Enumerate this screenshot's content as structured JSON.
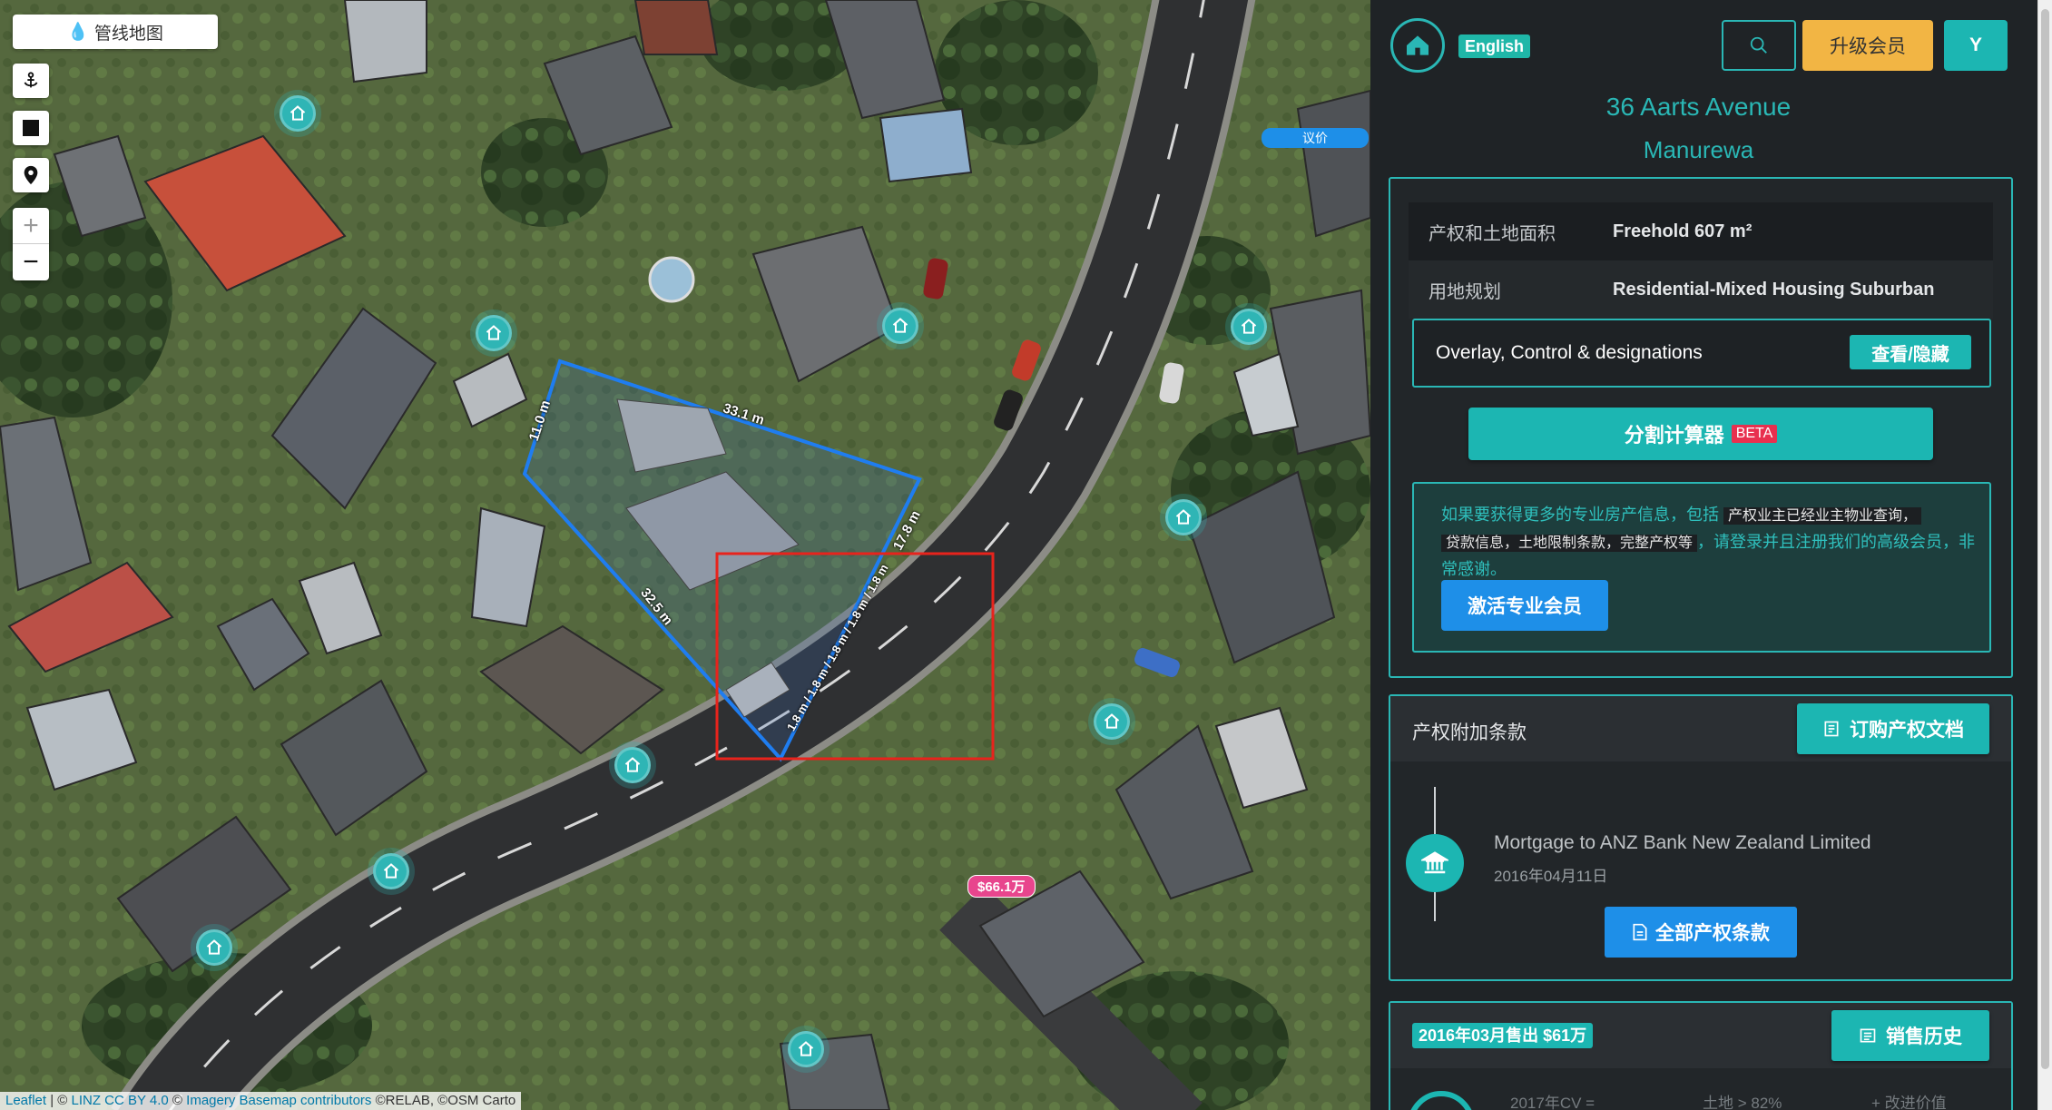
{
  "map": {
    "pipe_map_label": "管线地图",
    "tools": [
      "anchor-icon",
      "square-icon",
      "pin-icon"
    ],
    "zoom_in": "+",
    "zoom_out": "−",
    "price_pill_top": "议价",
    "price_pill_bottom": "$66.1万",
    "dimensions": {
      "top": "33.1 m",
      "left": "11.0 m",
      "bottom": "32.5 m",
      "right": "17.8 m",
      "curve": "1.8 m / 1.8 m / 1.8 m / 1.8 m / 1.8 m"
    },
    "attribution": {
      "leaflet": "Leaflet",
      "sep1": " | © ",
      "linz": "LINZ CC BY 4.0",
      "sep2": " © ",
      "imagery": "Imagery Basemap contributors",
      "rest": " ©RELAB, ©OSM Carto"
    }
  },
  "topbar": {
    "lang": "English",
    "upgrade": "升级会员",
    "avatar": "Y"
  },
  "address": {
    "street": "36 Aarts Avenue",
    "suburb": "Manurewa"
  },
  "property": {
    "tenure_label": "产权和土地面积",
    "tenure_value": "Freehold 607 m²",
    "zoning_label": "用地规划",
    "zoning_value": "Residential-Mixed Housing Suburban",
    "overlay_label": "Overlay, Control & designations",
    "overlay_btn": "查看/隐藏",
    "split_btn": "分割计算器",
    "beta": "BETA"
  },
  "promo": {
    "text_a": "如果要获得更多的专业房产信息，包括 ",
    "highlight_a": "产权业主已经业主物业查询，",
    "highlight_b": "贷款信息，土地限制条款，完整产权等",
    "text_b": "，请登录并且注册我们的高级会员，非常感谢。",
    "button": "激活专业会员"
  },
  "title_clauses": {
    "heading": "产权附加条款",
    "order_btn": "订购产权文档",
    "mortgage": "Mortgage to ANZ Bank New Zealand Limited",
    "mortgage_date": "2016年04月11日",
    "all_btn": "全部产权条款"
  },
  "sales": {
    "badge": "2016年03月售出 $61万",
    "history_btn": "销售历史",
    "partial": [
      "2017年CV =",
      "土地 > 82%",
      "+ 改进价值"
    ]
  },
  "colors": {
    "accent": "#1cb6b2",
    "upgrade": "#f2b544",
    "blue": "#1e8fe8",
    "beta": "#e8304f",
    "boundary": "#1f7df0",
    "selection": "#e8231c"
  }
}
